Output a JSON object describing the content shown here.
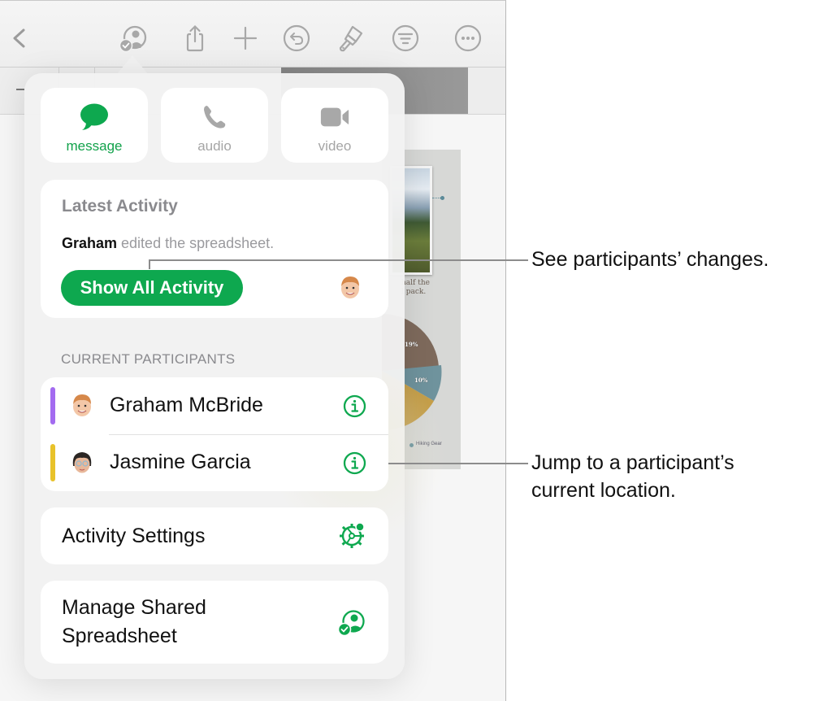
{
  "toolbar": {
    "icons": [
      "back-chevron-icon",
      "collaborate-icon",
      "share-icon",
      "add-icon",
      "undo-icon",
      "format-brush-icon",
      "organize-filter-icon",
      "more-icon"
    ]
  },
  "document_preview": {
    "caption_line1": "half the",
    "caption_line2": "l pack.",
    "pie_labels": [
      "19%",
      "10%"
    ],
    "legend_item": "Hiking Gear"
  },
  "popover": {
    "communication": [
      {
        "label": "message",
        "icon": "message-bubble-icon",
        "active": true
      },
      {
        "label": "audio",
        "icon": "phone-icon",
        "active": false
      },
      {
        "label": "video",
        "icon": "video-camera-icon",
        "active": false
      }
    ],
    "latest_activity": {
      "title": "Latest Activity",
      "actor": "Graham",
      "action": " edited the spreadsheet.",
      "button_label": "Show All Activity"
    },
    "participants_header": "CURRENT PARTICIPANTS",
    "participants": [
      {
        "name": "Graham McBride",
        "color": "#a36bf0"
      },
      {
        "name": "Jasmine Garcia",
        "color": "#e8c22a"
      }
    ],
    "activity_settings_label": "Activity Settings",
    "manage_label_line1": "Manage Shared",
    "manage_label_line2": "Spreadsheet"
  },
  "callouts": {
    "changes": "See participants’ changes.",
    "jump_line1": "Jump to a participant’s",
    "jump_line2": "current location."
  },
  "colors": {
    "accent_green": "#0ea84f",
    "icon_gray": "#a8a8a8"
  }
}
